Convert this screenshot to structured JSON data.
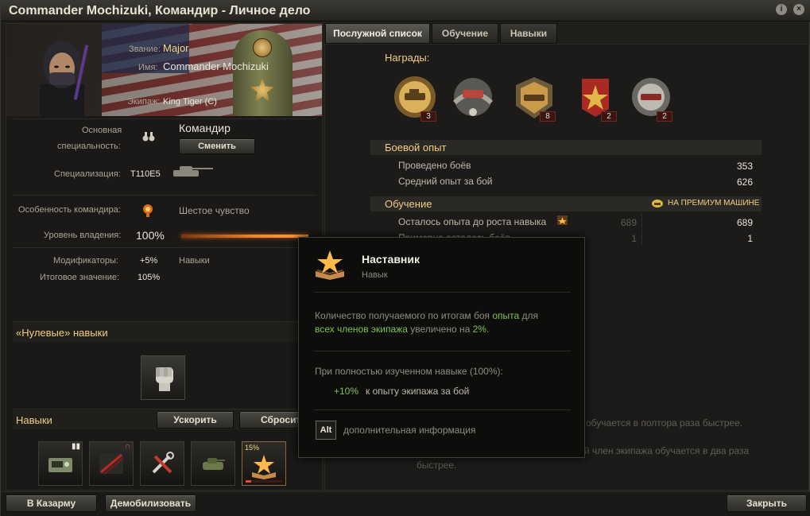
{
  "window": {
    "title": "Commander Mochizuki, Командир - Личное дело"
  },
  "profile": {
    "rank_label": "Звание:",
    "rank": "Major",
    "name_label": "Имя:",
    "name": "Commander Mochizuki",
    "crew_label": "Экипаж:",
    "crew": "King Tiger (C)"
  },
  "specialty": {
    "label_line1": "Основная",
    "label_line2": "специальность:",
    "value": "Командир",
    "change_button": "Сменить",
    "spec_label": "Специализация:",
    "spec_value": "T110E5",
    "feature_label": "Особенность командира:",
    "feature_value": "Шестое чувство",
    "mastery_label": "Уровень владения:",
    "mastery_value": "100%",
    "mastery_progress": 1.0,
    "modifiers_label": "Модификаторы:",
    "modifiers_value": "+5%",
    "modifiers_note": "Навыки",
    "final_label": "Итоговое значение:",
    "final_value": "105%"
  },
  "zero_skills": {
    "title": "«Нулевые» навыки"
  },
  "skills": {
    "title": "Навыки",
    "accelerate_button": "Ускорить",
    "reset_button": "Сбросить",
    "items": [
      {
        "icon": "radio-icon"
      },
      {
        "icon": "recon-icon"
      },
      {
        "icon": "repair-icon"
      },
      {
        "icon": "camouflage-icon"
      },
      {
        "icon": "mentor-icon",
        "progress_label": "15%"
      }
    ]
  },
  "tabs": [
    {
      "label": "Послужной список"
    },
    {
      "label": "Обучение"
    },
    {
      "label": "Навыки"
    }
  ],
  "awards": {
    "title": "Награды:",
    "items": [
      {
        "icon": "ace-tanker-medal-icon",
        "count": "3"
      },
      {
        "icon": "scout-medal-icon",
        "count": ""
      },
      {
        "icon": "tank-class-medal-icon",
        "count": "8"
      },
      {
        "icon": "red-star-medal-icon",
        "count": "2"
      },
      {
        "icon": "silver-medal-icon",
        "count": "2"
      }
    ]
  },
  "combat": {
    "title": "Боевой опыт",
    "battles_label": "Проведено боёв",
    "battles_value": "353",
    "avg_xp_label": "Средний опыт за бой",
    "avg_xp_value": "626"
  },
  "training": {
    "title": "Обучение",
    "premium_label": "НА ПРЕМИУМ МАШИНЕ",
    "xp_left_label": "Осталось опыта до роста навыка",
    "xp_left_value": "689",
    "xp_left_value_premium": "689",
    "battles_left_label": "Примерно осталось боёв",
    "battles_left_value": "1",
    "battles_left_value_premium": "1"
  },
  "tooltip": {
    "title": "Наставник",
    "subtitle": "Навык",
    "desc_part1": "Количество получаемого по итогам боя ",
    "desc_highlight1": "опыта",
    "desc_part2": " для",
    "desc_highlight2": "всех членов экипажа",
    "desc_part3": " увеличено на ",
    "desc_highlight3": "2%",
    "desc_part4": ".",
    "full_label": "При полностью изученном навыке (100%):",
    "bonus_value": "+10%",
    "bonus_text": "к опыту экипажа за бой",
    "alt_key": "Alt",
    "alt_text": "дополнительная информация"
  },
  "under_text": {
    "line1": "обучается в полтора раза быстрее.",
    "line2": "й член экипажа обучается в два раза",
    "line3": "быстрее."
  },
  "footer": {
    "barracks_button": "В Казарму",
    "demobilize_button": "Демобилизовать",
    "close_button": "Закрыть"
  }
}
